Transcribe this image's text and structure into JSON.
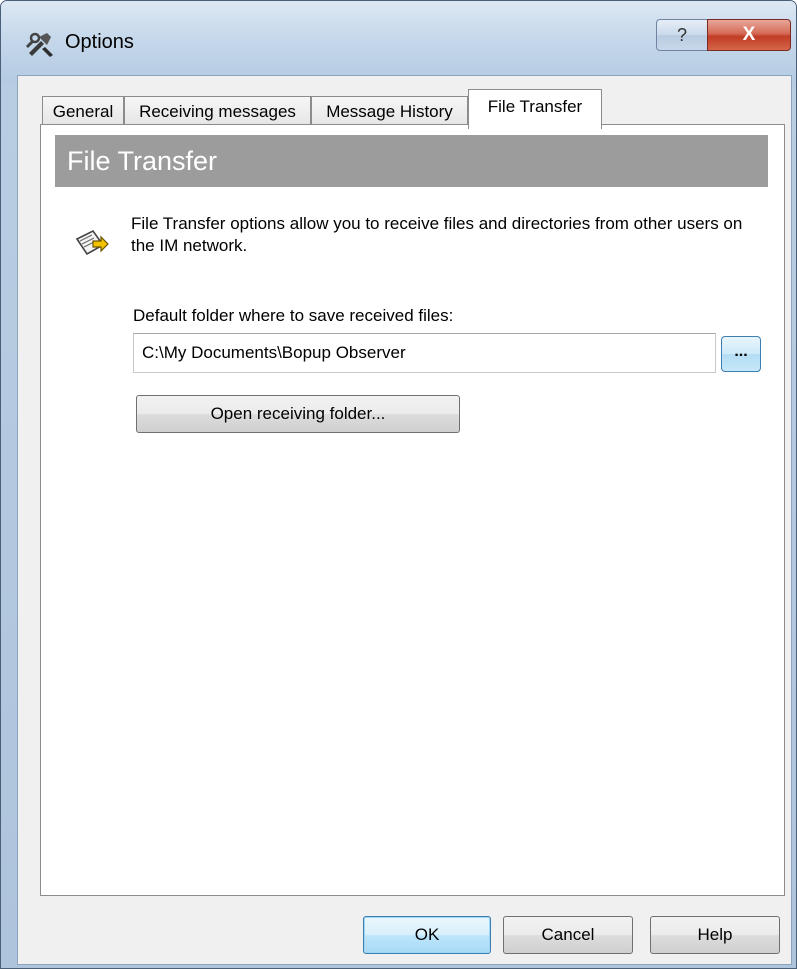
{
  "window": {
    "title": "Options",
    "icon": "tools-icon",
    "help_glyph": "?",
    "close_glyph": "X"
  },
  "tabs": [
    {
      "label": "General",
      "active": false
    },
    {
      "label": "Receiving messages",
      "active": false
    },
    {
      "label": "Message History",
      "active": false
    },
    {
      "label": "File Transfer",
      "active": true
    }
  ],
  "panel": {
    "banner_title": "File Transfer",
    "description": "File Transfer options allow you to receive files and directories from other users on the IM network.",
    "description_icon": "file-transfer-icon",
    "folder_label": "Default folder where to save received files:",
    "folder_value": "C:\\My Documents\\Bopup Observer",
    "browse_label": "...",
    "open_folder_label": "Open receiving folder..."
  },
  "buttons": {
    "ok": "OK",
    "cancel": "Cancel",
    "help": "Help"
  },
  "colors": {
    "banner_bg": "#9c9c9c",
    "banner_text": "#ffffff",
    "close_button": "#c13d25",
    "default_button_border": "#3c7fb1"
  }
}
